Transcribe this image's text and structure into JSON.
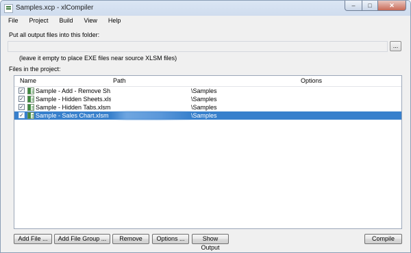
{
  "window": {
    "title": "Samples.xcp - xlCompiler"
  },
  "menu": {
    "items": [
      "File",
      "Project",
      "Build",
      "View",
      "Help"
    ]
  },
  "output": {
    "label": "Put all output files into this folder:",
    "value": "",
    "browse_label": "...",
    "hint": "(leave it empty to place EXE files near source XLSM files)"
  },
  "files": {
    "label": "Files in the project:",
    "columns": {
      "name": "Name",
      "path": "Path",
      "options": "Options"
    },
    "rows": [
      {
        "name": "Sample - Add - Remove Sh...",
        "path": "\\Samples",
        "checked": true,
        "selected": false
      },
      {
        "name": "Sample - Hidden Sheets.xlsm",
        "path": "\\Samples",
        "checked": true,
        "selected": false
      },
      {
        "name": "Sample - Hidden Tabs.xlsm",
        "path": "\\Samples",
        "checked": true,
        "selected": false
      },
      {
        "name": "Sample - Sales Chart.xlsm",
        "path": "\\Samples",
        "checked": true,
        "selected": true
      }
    ]
  },
  "buttons": {
    "add_file": "Add File ...",
    "add_file_group": "Add File Group ...",
    "remove": "Remove",
    "options": "Options ...",
    "show_output": "Show Output",
    "compile": "Compile"
  },
  "colors": {
    "selection": "#3880cc",
    "window_frame": "#8a9db5",
    "close_button": "#c96a57"
  }
}
